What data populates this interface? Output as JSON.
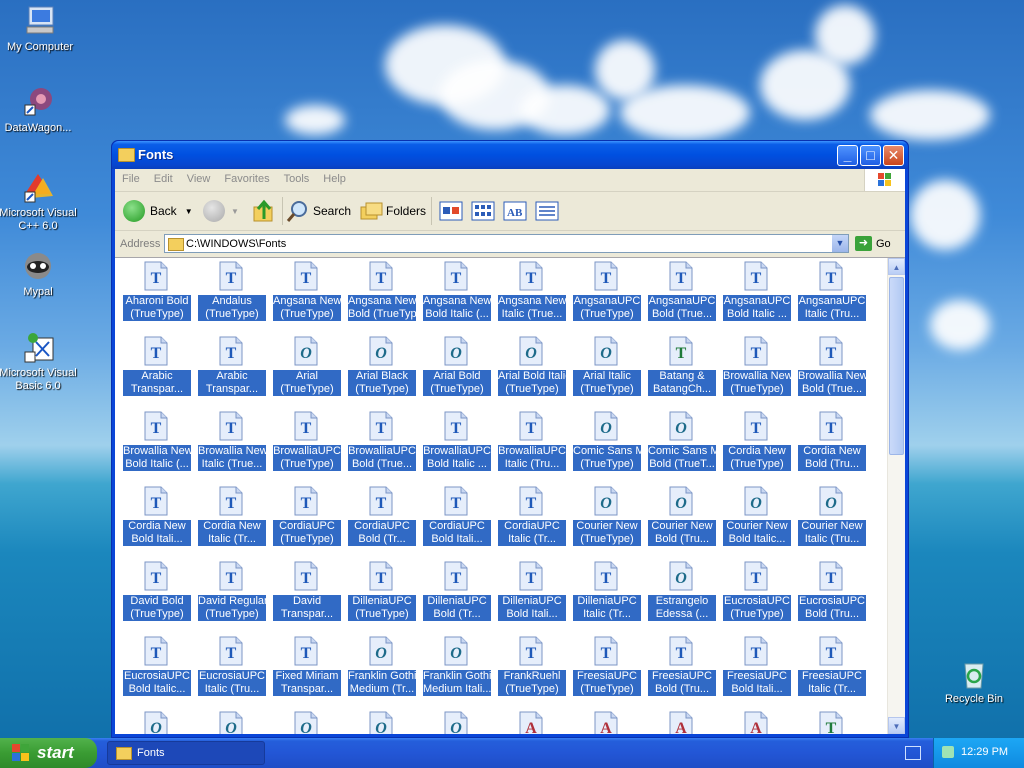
{
  "desktop": {
    "icons": [
      {
        "label": "My Computer",
        "icon": "my-computer-icon"
      },
      {
        "label": "DataWagon...",
        "icon": "datawagon-icon"
      },
      {
        "label": "Microsoft Visual C++ 6.0",
        "icon": "visual-cpp-icon"
      },
      {
        "label": "Mypal",
        "icon": "mypal-icon"
      },
      {
        "label": "Microsoft Visual Basic 6.0",
        "icon": "visual-basic-icon"
      }
    ],
    "recycle_bin": "Recycle Bin"
  },
  "window": {
    "title": "Fonts",
    "menu": [
      "File",
      "Edit",
      "View",
      "Favorites",
      "Tools",
      "Help"
    ],
    "toolbar": {
      "back": "Back",
      "search": "Search",
      "folders": "Folders"
    },
    "address": {
      "label": "Address",
      "value": "C:\\WINDOWS\\Fonts",
      "go": "Go"
    },
    "fonts": [
      [
        "Aharoni Bold",
        "(TrueType)",
        "T"
      ],
      [
        "Andalus",
        "(TrueType)",
        "T"
      ],
      [
        "Angsana New",
        "(TrueType)",
        "T"
      ],
      [
        "Angsana New",
        "Bold (TrueType)",
        "T"
      ],
      [
        "Angsana New",
        "Bold Italic (...",
        "T"
      ],
      [
        "Angsana New",
        "Italic (True...",
        "T"
      ],
      [
        "AngsanaUPC",
        "(TrueType)",
        "T"
      ],
      [
        "AngsanaUPC",
        "Bold (True...",
        "T"
      ],
      [
        "AngsanaUPC",
        "Bold Italic ...",
        "T"
      ],
      [
        "AngsanaUPC",
        "Italic (Tru...",
        "T"
      ],
      [
        "Arabic",
        "Transpar...",
        "T"
      ],
      [
        "Arabic",
        "Transpar...",
        "T"
      ],
      [
        "Arial",
        "(TrueType)",
        "O"
      ],
      [
        "Arial Black",
        "(TrueType)",
        "O"
      ],
      [
        "Arial Bold",
        "(TrueType)",
        "O"
      ],
      [
        "Arial Bold Italic",
        "(TrueType)",
        "O"
      ],
      [
        "Arial Italic",
        "(TrueType)",
        "O"
      ],
      [
        "Batang &",
        "BatangCh...",
        "TG"
      ],
      [
        "Browallia New",
        "(TrueType)",
        "T"
      ],
      [
        "Browallia New",
        "Bold (True...",
        "T"
      ],
      [
        "Browallia New",
        "Bold Italic (...",
        "T"
      ],
      [
        "Browallia New",
        "Italic (True...",
        "T"
      ],
      [
        "BrowalliaUPC",
        "(TrueType)",
        "T"
      ],
      [
        "BrowalliaUPC",
        "Bold (True...",
        "T"
      ],
      [
        "BrowalliaUPC",
        "Bold Italic ...",
        "T"
      ],
      [
        "BrowalliaUPC",
        "Italic (Tru...",
        "T"
      ],
      [
        "Comic Sans MS",
        "(TrueType)",
        "O"
      ],
      [
        "Comic Sans MS",
        "Bold (TrueT...",
        "O"
      ],
      [
        "Cordia New",
        "(TrueType)",
        "T"
      ],
      [
        "Cordia New",
        "Bold (Tru...",
        "T"
      ],
      [
        "Cordia New",
        "Bold Itali...",
        "T"
      ],
      [
        "Cordia New",
        "Italic (Tr...",
        "T"
      ],
      [
        "CordiaUPC",
        "(TrueType)",
        "T"
      ],
      [
        "CordiaUPC",
        "Bold (Tr...",
        "T"
      ],
      [
        "CordiaUPC",
        "Bold Itali...",
        "T"
      ],
      [
        "CordiaUPC",
        "Italic (Tr...",
        "T"
      ],
      [
        "Courier New",
        "(TrueType)",
        "O"
      ],
      [
        "Courier New",
        "Bold (Tru...",
        "O"
      ],
      [
        "Courier New",
        "Bold Italic...",
        "O"
      ],
      [
        "Courier New",
        "Italic (Tru...",
        "O"
      ],
      [
        "David Bold",
        "(TrueType)",
        "T"
      ],
      [
        "David Regular",
        "(TrueType)",
        "T"
      ],
      [
        "David",
        "Transpar...",
        "T"
      ],
      [
        "DilleniaUPC",
        "(TrueType)",
        "T"
      ],
      [
        "DilleniaUPC",
        "Bold (Tr...",
        "T"
      ],
      [
        "DilleniaUPC",
        "Bold Itali...",
        "T"
      ],
      [
        "DilleniaUPC",
        "Italic (Tr...",
        "T"
      ],
      [
        "Estrangelo",
        "Edessa (...",
        "O"
      ],
      [
        "EucrosiaUPC",
        "(TrueType)",
        "T"
      ],
      [
        "EucrosiaUPC",
        "Bold (Tru...",
        "T"
      ],
      [
        "EucrosiaUPC",
        "Bold Italic...",
        "T"
      ],
      [
        "EucrosiaUPC",
        "Italic (Tru...",
        "T"
      ],
      [
        "Fixed Miriam",
        "Transpar...",
        "T"
      ],
      [
        "Franklin Gothic",
        "Medium (Tr...",
        "O"
      ],
      [
        "Franklin Gothic",
        "Medium Itali...",
        "O"
      ],
      [
        "FrankRuehl",
        "(TrueType)",
        "T"
      ],
      [
        "FreesiaUPC",
        "(TrueType)",
        "T"
      ],
      [
        "FreesiaUPC",
        "Bold (Tru...",
        "T"
      ],
      [
        "FreesiaUPC",
        "Bold Itali...",
        "T"
      ],
      [
        "FreesiaUPC",
        "Italic (Tr...",
        "T"
      ],
      [
        "",
        "",
        "O"
      ],
      [
        "",
        "",
        "O"
      ],
      [
        "",
        "",
        "O"
      ],
      [
        "",
        "",
        "O"
      ],
      [
        "",
        "",
        "O"
      ],
      [
        "",
        "",
        "A"
      ],
      [
        "",
        "",
        "A"
      ],
      [
        "",
        "",
        "A"
      ],
      [
        "",
        "",
        "A"
      ],
      [
        "",
        "",
        "TG"
      ]
    ]
  },
  "taskbar": {
    "start": "start",
    "task": "Fonts",
    "clock": "12:29 PM"
  },
  "colors": {
    "selection": "#316ac5",
    "title_blue": "#0050e0",
    "taskbar_blue": "#245edb",
    "start_green": "#3a9c33"
  }
}
